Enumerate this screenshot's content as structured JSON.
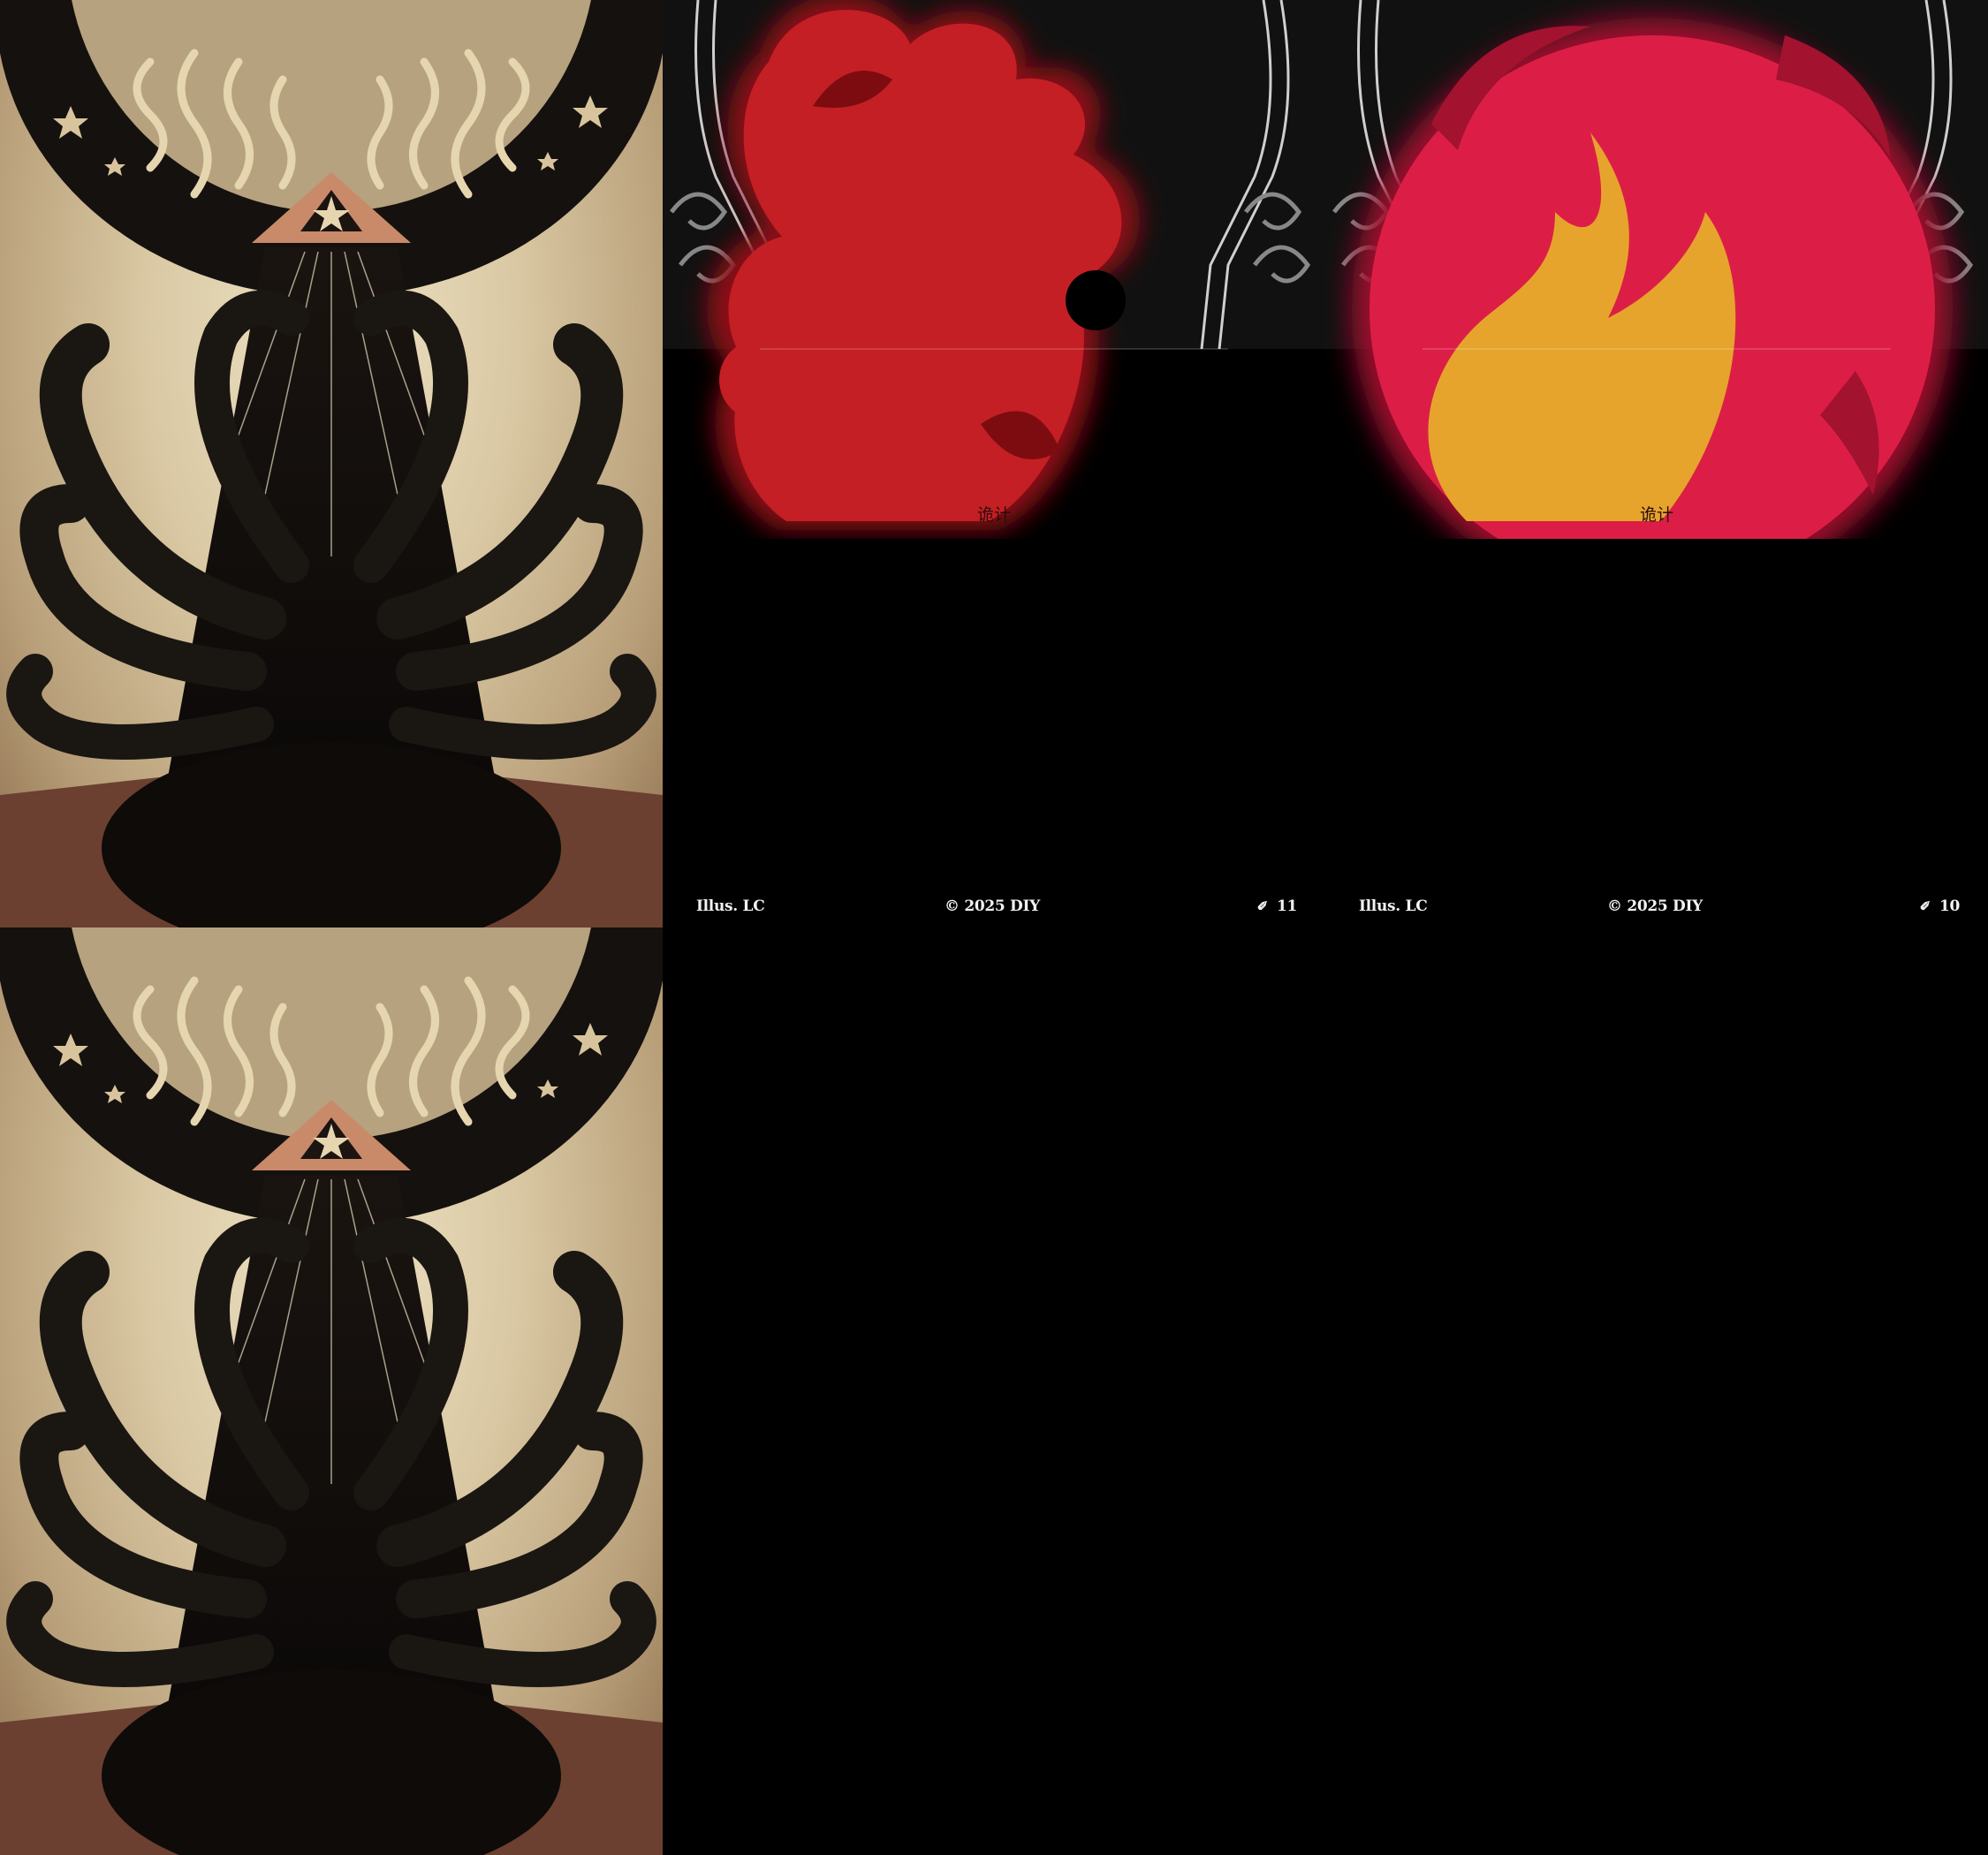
{
  "sheet": {
    "card_backs": [
      {
        "name": "card-back-1"
      },
      {
        "name": "card-back-2"
      }
    ],
    "card_faces": [
      {
        "art": "red-splatter",
        "design_label": "诡计",
        "illus": "Illus. LC",
        "copyright": "© 2025 DIY",
        "number": "11",
        "icon": "pen-icon"
      },
      {
        "art": "flame",
        "design_label": "诡计",
        "illus": "Illus. LC",
        "copyright": "© 2025 DIY",
        "number": "10",
        "icon": "pen-icon"
      }
    ]
  },
  "colors": {
    "background": "#000000",
    "parchment": "#d9c8a3",
    "tentacle": "#1a1612",
    "blood_red": "#c41f24",
    "flame_red": "#dc1e47",
    "flame_gold": "#e6a42c",
    "frame_white": "#ffffff"
  }
}
